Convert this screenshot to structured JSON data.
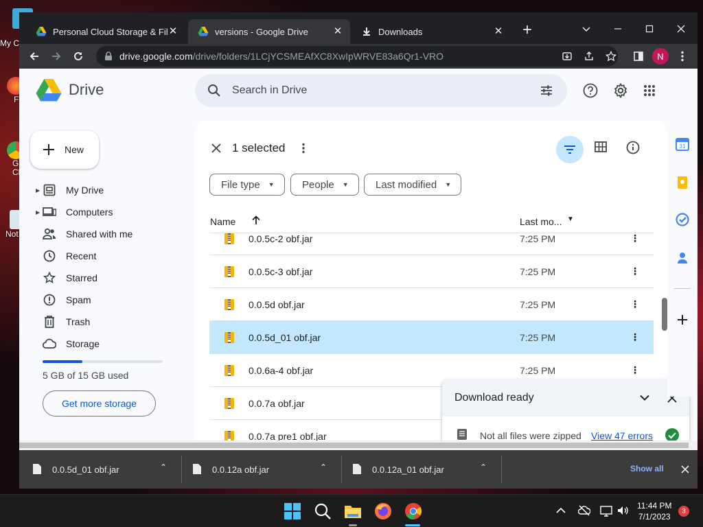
{
  "desktop": {
    "icons": [
      {
        "label": "My C"
      },
      {
        "label": "F"
      },
      {
        "label": "G\nCh"
      },
      {
        "label": "Not"
      }
    ]
  },
  "browser": {
    "tabs": [
      {
        "title": "Personal Cloud Storage & File Sh",
        "active": false
      },
      {
        "title": "versions - Google Drive",
        "active": true
      },
      {
        "title": "Downloads",
        "active": false
      }
    ],
    "url_host": "drive.google.com",
    "url_path": "/drive/folders/1LCjYCSMEAfXC8XwIpWRVE83a6Qr1-VRO",
    "profile_initial": "N"
  },
  "drive": {
    "app_name": "Drive",
    "search_placeholder": "Search in Drive",
    "profile_initial": "N",
    "new_label": "New",
    "nav": [
      {
        "label": "My Drive",
        "icon": "my-drive-icon",
        "caret": true
      },
      {
        "label": "Computers",
        "icon": "computers-icon",
        "caret": true
      },
      {
        "label": "Shared with me",
        "icon": "shared-icon",
        "caret": false
      },
      {
        "label": "Recent",
        "icon": "clock-icon",
        "caret": false
      },
      {
        "label": "Starred",
        "icon": "star-icon",
        "caret": false
      },
      {
        "label": "Spam",
        "icon": "spam-icon",
        "caret": false
      },
      {
        "label": "Trash",
        "icon": "trash-icon",
        "caret": false
      },
      {
        "label": "Storage",
        "icon": "cloud-icon",
        "caret": false
      }
    ],
    "storage": {
      "used_text": "5 GB of 15 GB used",
      "used_fraction": 0.33,
      "cta": "Get more storage"
    },
    "selection": {
      "count_text": "1 selected"
    },
    "filters": [
      {
        "label": "File type"
      },
      {
        "label": "People"
      },
      {
        "label": "Last modified"
      }
    ],
    "columns": {
      "name": "Name",
      "modified": "Last mo..."
    },
    "files": [
      {
        "name": "0.0.5c-2 obf.jar",
        "modified": "7:25 PM",
        "selected": false
      },
      {
        "name": "0.0.5c-3 obf.jar",
        "modified": "7:25 PM",
        "selected": false
      },
      {
        "name": "0.0.5d obf.jar",
        "modified": "7:25 PM",
        "selected": false
      },
      {
        "name": "0.0.5d_01 obf.jar",
        "modified": "7:25 PM",
        "selected": true
      },
      {
        "name": "0.0.6a-4 obf.jar",
        "modified": "7:25 PM",
        "selected": false
      },
      {
        "name": "0.0.7a obf.jar",
        "modified": "",
        "selected": false
      },
      {
        "name": "0.0.7a pre1 obf.jar",
        "modified": "",
        "selected": false
      }
    ],
    "download_toast": {
      "title": "Download ready",
      "message": "Not all files were zipped",
      "link": "View 47 errors"
    }
  },
  "downloads_shelf": {
    "items": [
      {
        "name": "0.0.5d_01 obf.jar"
      },
      {
        "name": "0.0.12a obf.jar"
      },
      {
        "name": "0.0.12a_01 obf.jar"
      }
    ],
    "show_all": "Show all"
  },
  "taskbar": {
    "time": "11:44 PM",
    "date": "7/1/2023",
    "notification_count": "3"
  },
  "colors": {
    "drive_blue": "#0b57d0",
    "selected_row": "#c2e7ff",
    "chrome_dark": "#202124",
    "success_green": "#1e8e3e"
  }
}
